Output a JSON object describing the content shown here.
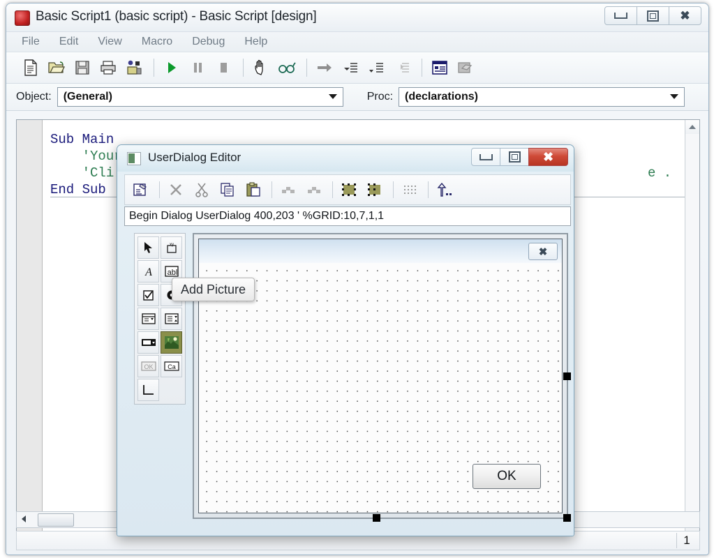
{
  "window": {
    "title": "Basic Script1 (basic script) - Basic Script [design]",
    "icon": "basic-script-app-icon",
    "controls": {
      "minimize": "minimize-icon",
      "maximize": "maximize-icon",
      "close": "close-icon"
    }
  },
  "menubar": {
    "items": [
      "File",
      "Edit",
      "View",
      "Macro",
      "Debug",
      "Help"
    ]
  },
  "toolbar": {
    "items": [
      {
        "name": "new-file-icon",
        "title": "New"
      },
      {
        "name": "open-file-icon",
        "title": "Open"
      },
      {
        "name": "save-icon",
        "title": "Save"
      },
      {
        "name": "print-icon",
        "title": "Print"
      },
      {
        "name": "object-browser-icon",
        "title": "Object Browser"
      },
      {
        "name": "run-icon",
        "title": "Run"
      },
      {
        "name": "pause-icon",
        "title": "Pause"
      },
      {
        "name": "stop-icon",
        "title": "Stop"
      },
      {
        "name": "hand-icon",
        "title": "Toggle Breakpoint"
      },
      {
        "name": "glasses-icon",
        "title": "Quick Watch"
      },
      {
        "name": "arrow-right-icon",
        "title": "Set Next Statement"
      },
      {
        "name": "step-into-icon",
        "title": "Step Into"
      },
      {
        "name": "step-over-icon",
        "title": "Step Over"
      },
      {
        "name": "step-out-icon",
        "title": "Step Out"
      },
      {
        "name": "dialog-editor-icon",
        "title": "UserDialog Editor"
      },
      {
        "name": "references-icon",
        "title": "References"
      }
    ]
  },
  "selectors": {
    "object_label": "Object:",
    "object_value": "(General)",
    "proc_label": "Proc:",
    "proc_value": "(declarations)"
  },
  "code": {
    "line1": "Sub Main",
    "line2": "    'Your",
    "line3": "    'Cli",
    "line4": "End Sub",
    "tail": "e ."
  },
  "statusbar": {
    "line_number": "1"
  },
  "dialog_editor": {
    "title": "UserDialog Editor",
    "icon": "dialog-window-icon",
    "controls": {
      "minimize": "minimize-icon",
      "maximize": "maximize-icon",
      "close": "close-icon"
    },
    "toolbar": [
      {
        "name": "edit-properties-icon",
        "title": "Properties"
      },
      {
        "name": "delete-icon",
        "title": "Delete"
      },
      {
        "name": "cut-icon",
        "title": "Cut"
      },
      {
        "name": "copy-icon",
        "title": "Copy"
      },
      {
        "name": "paste-icon",
        "title": "Paste"
      },
      {
        "name": "undo-icon",
        "title": "Undo"
      },
      {
        "name": "redo-icon",
        "title": "Redo"
      },
      {
        "name": "align-left-icon",
        "title": "Align Left"
      },
      {
        "name": "align-right-icon",
        "title": "Align Right"
      },
      {
        "name": "grid-icon",
        "title": "Grid"
      },
      {
        "name": "tab-order-icon",
        "title": "Tab Order"
      }
    ],
    "code_line": "Begin Dialog UserDialog 400,203 ' %GRID:10,7,1,1",
    "palette": [
      {
        "name": "pointer-tool",
        "title": "Select"
      },
      {
        "name": "xy-position-tool",
        "title": "Position"
      },
      {
        "name": "text-tool",
        "title": "Add Text"
      },
      {
        "name": "textbox-tool",
        "title": "Add TextBox"
      },
      {
        "name": "checkbox-tool",
        "title": "Add CheckBox"
      },
      {
        "name": "option-button-tool",
        "title": "Add OptionButton"
      },
      {
        "name": "listbox-tool",
        "title": "Add ListBox"
      },
      {
        "name": "combobox-tool",
        "title": "Add ComboBox"
      },
      {
        "name": "droplistbox-tool",
        "title": "Add DropListBox"
      },
      {
        "name": "picture-tool",
        "title": "Add Picture",
        "selected": true
      },
      {
        "name": "okbutton-tool",
        "title": "Add OK Button"
      },
      {
        "name": "cancelbutton-tool",
        "title": "Add Cancel Button"
      },
      {
        "name": "groupbox-tool",
        "title": "Add GroupBox"
      }
    ],
    "tooltip": "Add Picture",
    "canvas": {
      "close_glyph": "close-icon",
      "ok_button": "OK"
    }
  },
  "colors": {
    "accent": "#cf4b38",
    "keyword": "#19197a",
    "comment": "#2e7d52",
    "selected_tool": "#8a8f4a"
  }
}
